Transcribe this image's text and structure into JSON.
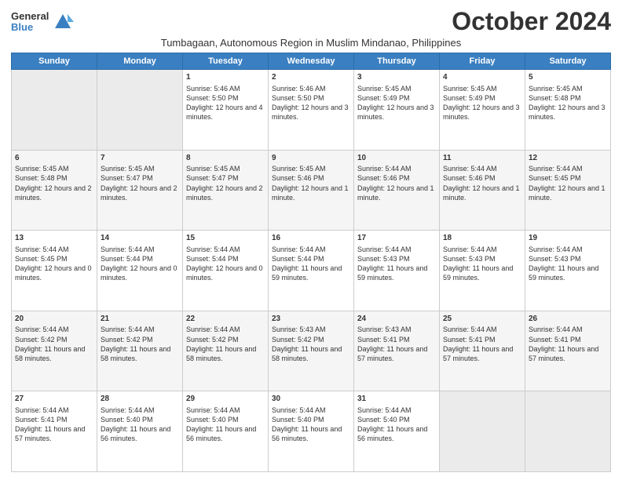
{
  "logo": {
    "general": "General",
    "blue": "Blue"
  },
  "title": "October 2024",
  "subtitle": "Tumbagaan, Autonomous Region in Muslim Mindanao, Philippines",
  "days_of_week": [
    "Sunday",
    "Monday",
    "Tuesday",
    "Wednesday",
    "Thursday",
    "Friday",
    "Saturday"
  ],
  "weeks": [
    [
      {
        "day": "",
        "content": ""
      },
      {
        "day": "",
        "content": ""
      },
      {
        "day": "1",
        "content": "Sunrise: 5:46 AM\nSunset: 5:50 PM\nDaylight: 12 hours and 4 minutes."
      },
      {
        "day": "2",
        "content": "Sunrise: 5:46 AM\nSunset: 5:50 PM\nDaylight: 12 hours and 3 minutes."
      },
      {
        "day": "3",
        "content": "Sunrise: 5:45 AM\nSunset: 5:49 PM\nDaylight: 12 hours and 3 minutes."
      },
      {
        "day": "4",
        "content": "Sunrise: 5:45 AM\nSunset: 5:49 PM\nDaylight: 12 hours and 3 minutes."
      },
      {
        "day": "5",
        "content": "Sunrise: 5:45 AM\nSunset: 5:48 PM\nDaylight: 12 hours and 3 minutes."
      }
    ],
    [
      {
        "day": "6",
        "content": "Sunrise: 5:45 AM\nSunset: 5:48 PM\nDaylight: 12 hours and 2 minutes."
      },
      {
        "day": "7",
        "content": "Sunrise: 5:45 AM\nSunset: 5:47 PM\nDaylight: 12 hours and 2 minutes."
      },
      {
        "day": "8",
        "content": "Sunrise: 5:45 AM\nSunset: 5:47 PM\nDaylight: 12 hours and 2 minutes."
      },
      {
        "day": "9",
        "content": "Sunrise: 5:45 AM\nSunset: 5:46 PM\nDaylight: 12 hours and 1 minute."
      },
      {
        "day": "10",
        "content": "Sunrise: 5:44 AM\nSunset: 5:46 PM\nDaylight: 12 hours and 1 minute."
      },
      {
        "day": "11",
        "content": "Sunrise: 5:44 AM\nSunset: 5:46 PM\nDaylight: 12 hours and 1 minute."
      },
      {
        "day": "12",
        "content": "Sunrise: 5:44 AM\nSunset: 5:45 PM\nDaylight: 12 hours and 1 minute."
      }
    ],
    [
      {
        "day": "13",
        "content": "Sunrise: 5:44 AM\nSunset: 5:45 PM\nDaylight: 12 hours and 0 minutes."
      },
      {
        "day": "14",
        "content": "Sunrise: 5:44 AM\nSunset: 5:44 PM\nDaylight: 12 hours and 0 minutes."
      },
      {
        "day": "15",
        "content": "Sunrise: 5:44 AM\nSunset: 5:44 PM\nDaylight: 12 hours and 0 minutes."
      },
      {
        "day": "16",
        "content": "Sunrise: 5:44 AM\nSunset: 5:44 PM\nDaylight: 11 hours and 59 minutes."
      },
      {
        "day": "17",
        "content": "Sunrise: 5:44 AM\nSunset: 5:43 PM\nDaylight: 11 hours and 59 minutes."
      },
      {
        "day": "18",
        "content": "Sunrise: 5:44 AM\nSunset: 5:43 PM\nDaylight: 11 hours and 59 minutes."
      },
      {
        "day": "19",
        "content": "Sunrise: 5:44 AM\nSunset: 5:43 PM\nDaylight: 11 hours and 59 minutes."
      }
    ],
    [
      {
        "day": "20",
        "content": "Sunrise: 5:44 AM\nSunset: 5:42 PM\nDaylight: 11 hours and 58 minutes."
      },
      {
        "day": "21",
        "content": "Sunrise: 5:44 AM\nSunset: 5:42 PM\nDaylight: 11 hours and 58 minutes."
      },
      {
        "day": "22",
        "content": "Sunrise: 5:44 AM\nSunset: 5:42 PM\nDaylight: 11 hours and 58 minutes."
      },
      {
        "day": "23",
        "content": "Sunrise: 5:43 AM\nSunset: 5:42 PM\nDaylight: 11 hours and 58 minutes."
      },
      {
        "day": "24",
        "content": "Sunrise: 5:43 AM\nSunset: 5:41 PM\nDaylight: 11 hours and 57 minutes."
      },
      {
        "day": "25",
        "content": "Sunrise: 5:44 AM\nSunset: 5:41 PM\nDaylight: 11 hours and 57 minutes."
      },
      {
        "day": "26",
        "content": "Sunrise: 5:44 AM\nSunset: 5:41 PM\nDaylight: 11 hours and 57 minutes."
      }
    ],
    [
      {
        "day": "27",
        "content": "Sunrise: 5:44 AM\nSunset: 5:41 PM\nDaylight: 11 hours and 57 minutes."
      },
      {
        "day": "28",
        "content": "Sunrise: 5:44 AM\nSunset: 5:40 PM\nDaylight: 11 hours and 56 minutes."
      },
      {
        "day": "29",
        "content": "Sunrise: 5:44 AM\nSunset: 5:40 PM\nDaylight: 11 hours and 56 minutes."
      },
      {
        "day": "30",
        "content": "Sunrise: 5:44 AM\nSunset: 5:40 PM\nDaylight: 11 hours and 56 minutes."
      },
      {
        "day": "31",
        "content": "Sunrise: 5:44 AM\nSunset: 5:40 PM\nDaylight: 11 hours and 56 minutes."
      },
      {
        "day": "",
        "content": ""
      },
      {
        "day": "",
        "content": ""
      }
    ]
  ]
}
